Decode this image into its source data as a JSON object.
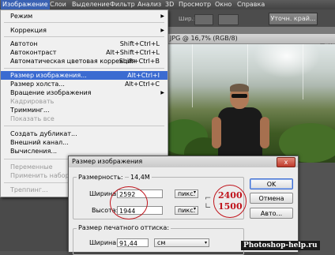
{
  "menubar": {
    "items": [
      "Изображение",
      "Слои",
      "Выделение",
      "Фильтр",
      "Анализ",
      "3D",
      "Просмотр",
      "Окно",
      "Справка"
    ]
  },
  "optbar": {
    "label_width": "Шир.:",
    "button": "Уточн. край..."
  },
  "document": {
    "title": "JPG @ 16,7% (RGB/8)"
  },
  "menu": {
    "items": [
      {
        "label": "Режим",
        "shortcut": "",
        "arrow": true,
        "disabled": false
      },
      {
        "label": "Коррекция",
        "shortcut": "",
        "arrow": true,
        "disabled": false
      },
      {
        "label": "Автотон",
        "shortcut": "Shift+Ctrl+L",
        "disabled": false
      },
      {
        "label": "Автоконтраст",
        "shortcut": "Alt+Shift+Ctrl+L",
        "disabled": false
      },
      {
        "label": "Автоматическая цветовая коррекция",
        "shortcut": "Shift+Ctrl+B",
        "disabled": false
      },
      {
        "label": "Размер изображения...",
        "shortcut": "Alt+Ctrl+I",
        "highlighted": true
      },
      {
        "label": "Размер холста...",
        "shortcut": "Alt+Ctrl+C",
        "disabled": false
      },
      {
        "label": "Вращение изображения",
        "shortcut": "",
        "arrow": true,
        "disabled": false
      },
      {
        "label": "Кадрировать",
        "shortcut": "",
        "disabled": true
      },
      {
        "label": "Тримминг...",
        "shortcut": "",
        "disabled": false
      },
      {
        "label": "Показать все",
        "shortcut": "",
        "disabled": true
      },
      {
        "label": "Создать дубликат...",
        "shortcut": "",
        "disabled": false
      },
      {
        "label": "Внешний канал...",
        "shortcut": "",
        "disabled": false
      },
      {
        "label": "Вычисления...",
        "shortcut": "",
        "disabled": false
      },
      {
        "label": "Переменные",
        "shortcut": "",
        "disabled": true
      },
      {
        "label": "Применить набор да",
        "shortcut": "",
        "disabled": true
      },
      {
        "label": "Треппинг...",
        "shortcut": "",
        "disabled": true
      }
    ]
  },
  "dialog": {
    "title": "Размер изображения",
    "close": "x",
    "dimensions_label": "Размерность:",
    "dimensions_value": "14,4M",
    "width_label": "Ширина:",
    "width_value": "2592",
    "width_unit": "пикс.",
    "height_label": "Высота:",
    "height_value": "1944",
    "height_unit": "пикс.",
    "print_size_label": "Размер печатного оттиска:",
    "print_width_label": "Ширина:",
    "print_width_value": "91,44",
    "print_width_unit": "см",
    "ok": "OK",
    "cancel": "Отмена",
    "auto": "Авто...",
    "annotation_width": "2400",
    "annotation_height": "1500"
  },
  "watermark": "Photoshop-help.ru",
  "colors": {
    "highlight": "#3b6bd1",
    "annotation": "#c0141c"
  }
}
